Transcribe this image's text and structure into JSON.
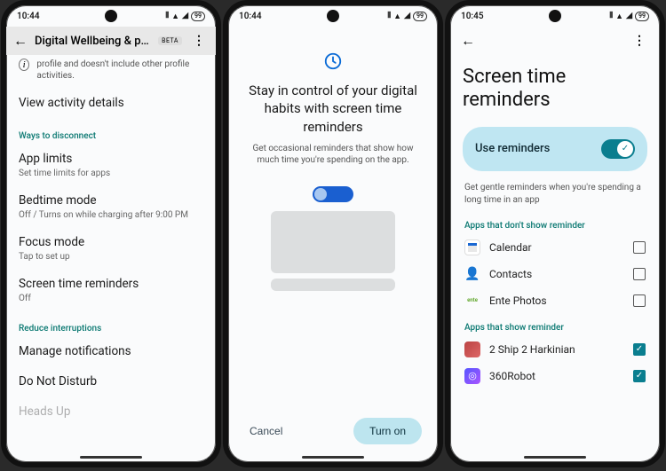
{
  "statusbar": {
    "time_a": "10:44",
    "time_b": "10:44",
    "time_c": "10:45",
    "battery": "99"
  },
  "screen1": {
    "title": "Digital Wellbeing & p…",
    "beta": "BETA",
    "info_text": "profile and doesn't include other profile activities.",
    "view_activity": "View activity details",
    "section_disconnect": "Ways to disconnect",
    "app_limits": {
      "title": "App limits",
      "sub": "Set time limits for apps"
    },
    "bedtime": {
      "title": "Bedtime mode",
      "sub": "Off / Turns on while charging after 9:00 PM"
    },
    "focus": {
      "title": "Focus mode",
      "sub": "Tap to set up"
    },
    "reminders": {
      "title": "Screen time reminders",
      "sub": "Off"
    },
    "section_reduce": "Reduce interruptions",
    "manage_notifications": "Manage notifications",
    "dnd": "Do Not Disturb",
    "heads": "Heads Up"
  },
  "screen2": {
    "headline": "Stay in control of your digital habits with screen time reminders",
    "sub": "Get occasional reminders that show how much time you're spending on the app.",
    "cancel": "Cancel",
    "turn_on": "Turn on"
  },
  "screen3": {
    "title": "Screen time reminders",
    "use_reminders": "Use reminders",
    "desc": "Get gentle reminders when you're spending a long time in an app",
    "section_no": "Apps that don't show reminder",
    "section_yes": "Apps that show reminder",
    "apps_no": [
      {
        "name": "Calendar"
      },
      {
        "name": "Contacts"
      },
      {
        "name": "Ente Photos"
      }
    ],
    "apps_yes": [
      {
        "name": "2 Ship 2 Harkinian"
      },
      {
        "name": "360Robot"
      }
    ]
  }
}
